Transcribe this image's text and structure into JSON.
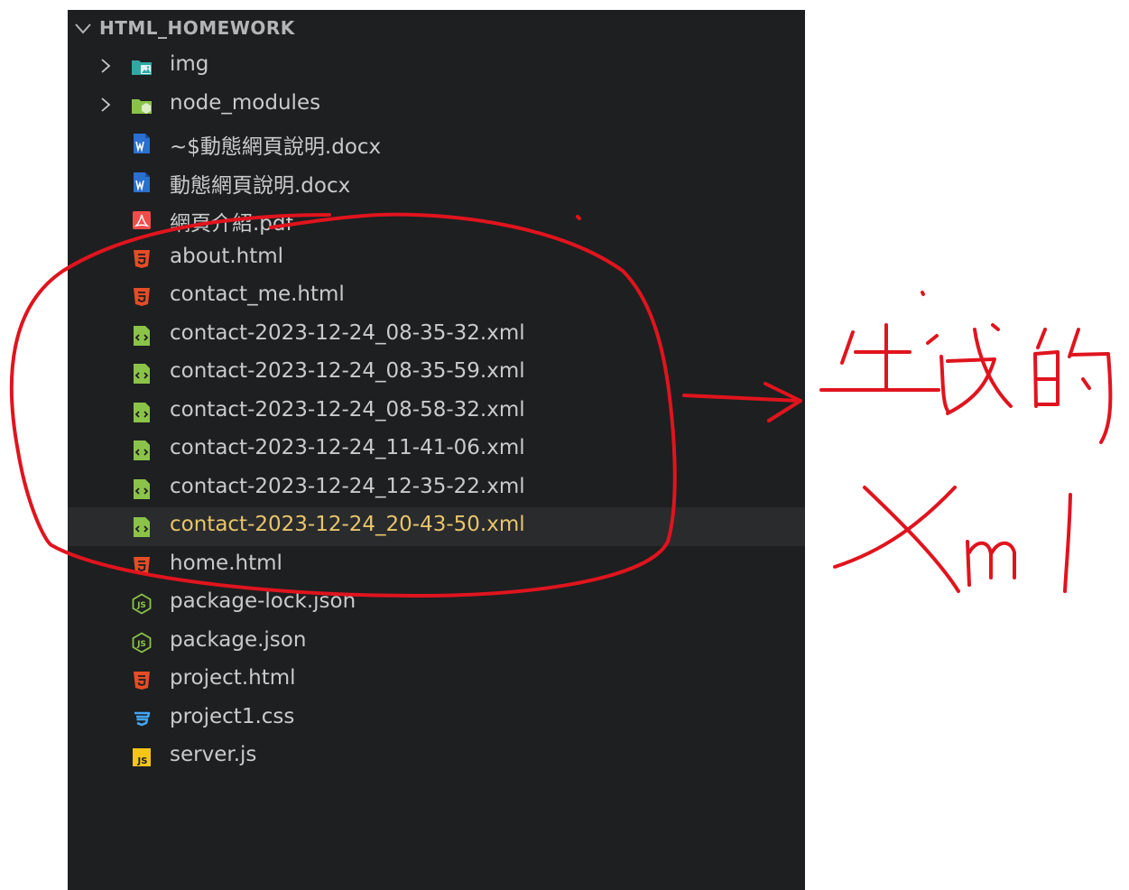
{
  "explorer": {
    "folder_name": "HTML_HOMEWORK",
    "items": [
      {
        "label": "img",
        "kind": "folder",
        "icon": "image-folder-icon"
      },
      {
        "label": "node_modules",
        "kind": "folder",
        "icon": "node-folder-icon"
      },
      {
        "label": "~$動態網頁說明.docx",
        "kind": "file",
        "icon": "word-file-icon"
      },
      {
        "label": "動態網頁說明.docx",
        "kind": "file",
        "icon": "word-file-icon"
      },
      {
        "label": "網頁介紹.pdf",
        "kind": "file",
        "icon": "pdf-file-icon"
      },
      {
        "label": "about.html",
        "kind": "file",
        "icon": "html5-file-icon"
      },
      {
        "label": "contact_me.html",
        "kind": "file",
        "icon": "html5-file-icon"
      },
      {
        "label": "contact-2023-12-24_08-35-32.xml",
        "kind": "file",
        "icon": "xml-file-icon"
      },
      {
        "label": "contact-2023-12-24_08-35-59.xml",
        "kind": "file",
        "icon": "xml-file-icon"
      },
      {
        "label": "contact-2023-12-24_08-58-32.xml",
        "kind": "file",
        "icon": "xml-file-icon"
      },
      {
        "label": "contact-2023-12-24_11-41-06.xml",
        "kind": "file",
        "icon": "xml-file-icon"
      },
      {
        "label": "contact-2023-12-24_12-35-22.xml",
        "kind": "file",
        "icon": "xml-file-icon"
      },
      {
        "label": "contact-2023-12-24_20-43-50.xml",
        "kind": "file",
        "icon": "xml-file-icon",
        "selected": true
      },
      {
        "label": "home.html",
        "kind": "file",
        "icon": "html5-file-icon"
      },
      {
        "label": "package-lock.json",
        "kind": "file",
        "icon": "nodejs-file-icon"
      },
      {
        "label": "package.json",
        "kind": "file",
        "icon": "nodejs-file-icon"
      },
      {
        "label": "project.html",
        "kind": "file",
        "icon": "html5-file-icon"
      },
      {
        "label": "project1.css",
        "kind": "file",
        "icon": "css3-file-icon"
      },
      {
        "label": "server.js",
        "kind": "file",
        "icon": "javascript-file-icon"
      }
    ]
  },
  "annotation": {
    "handwritten_line1": "生成的",
    "handwritten_line2": "Xml",
    "ink_color": "#e0141e"
  },
  "colors": {
    "panel_bg": "#1e1f20",
    "selected_row_bg": "#2a2b2d",
    "selected_text": "#e8c56b",
    "text": "#c9cacb"
  }
}
